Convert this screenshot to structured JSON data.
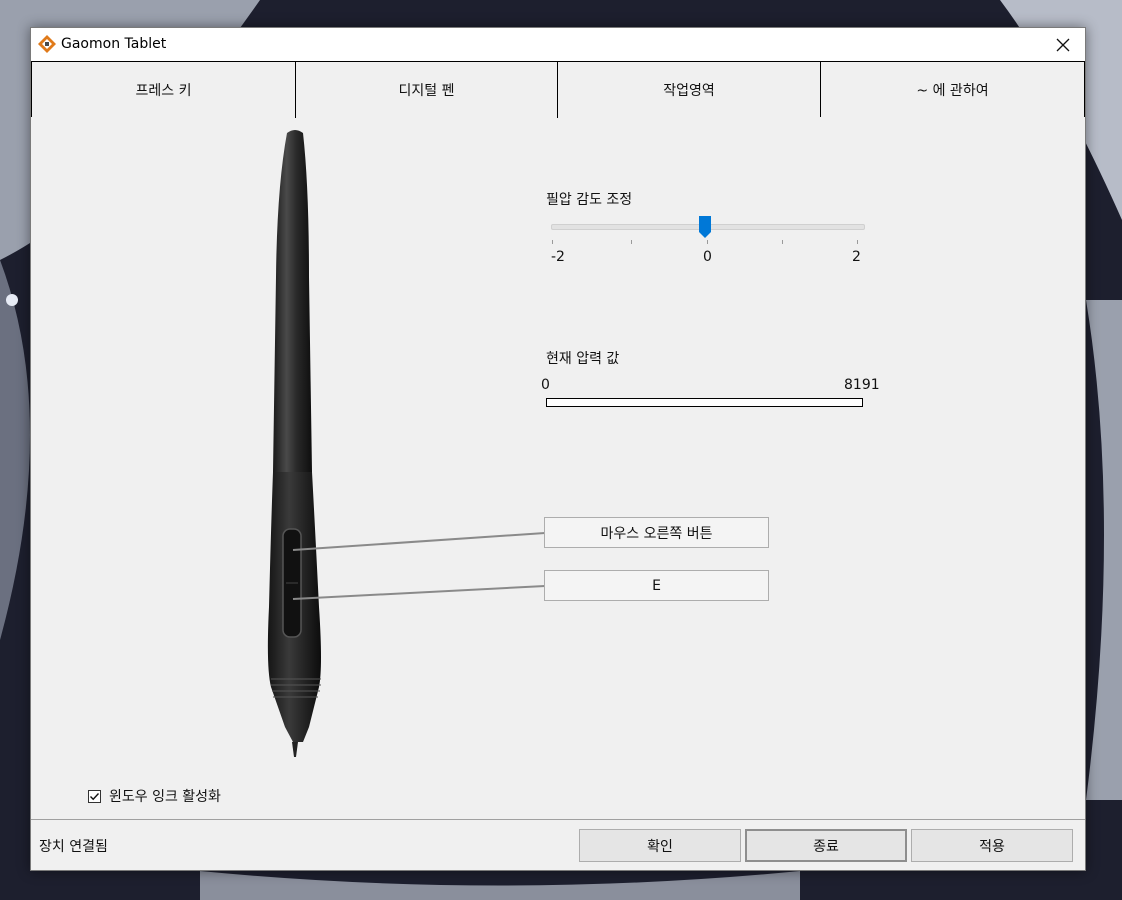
{
  "window": {
    "title": "Gaomon Tablet"
  },
  "tabs": [
    {
      "label": "프레스 키"
    },
    {
      "label": "디지털 펜"
    },
    {
      "label": "작업영역"
    },
    {
      "label": "~ 에 관하여"
    }
  ],
  "active_tab_index": 1,
  "sensitivity": {
    "label": "필압 감도 조정",
    "min_label": "-2",
    "mid_label": "0",
    "max_label": "2",
    "value": 0
  },
  "pressure": {
    "label": "현재 압력 값",
    "min_label": "0",
    "max_label": "8191",
    "current_fraction": 0
  },
  "pen_buttons": {
    "upper": "마우스 오른쪽 버튼",
    "lower": "E"
  },
  "windows_ink": {
    "label": "윈도우 잉크 활성화",
    "checked": true
  },
  "footer": {
    "status": "장치 연결됨",
    "ok_label": "확인",
    "exit_label": "종료",
    "apply_label": "적용"
  },
  "colors": {
    "accent": "#0078d7",
    "window_bg": "#f0f0f0",
    "progress_green": "#06b025"
  }
}
